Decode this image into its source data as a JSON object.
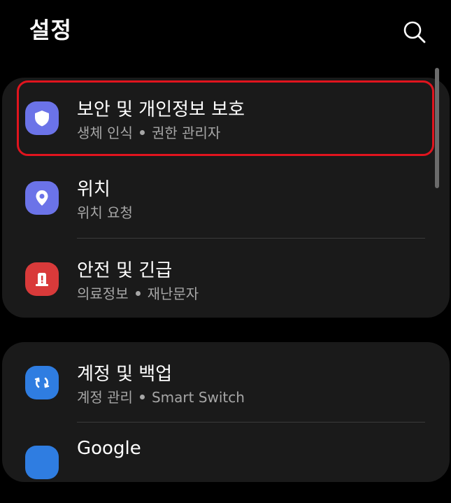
{
  "header": {
    "title": "설정"
  },
  "colors": {
    "highlight": "#e0141e",
    "security_icon_bg": "#6b73e8",
    "location_icon_bg": "#6b73e8",
    "safety_icon_bg": "#d93a3a",
    "accounts_icon_bg": "#2f7de1"
  },
  "groups": [
    {
      "items": [
        {
          "title": "보안 및 개인정보 보호",
          "sub_a": "생체 인식",
          "sub_b": "권한 관리자",
          "icon": "shield-icon"
        },
        {
          "title": "위치",
          "sub_a": "위치 요청",
          "icon": "location-pin-icon"
        },
        {
          "title": "안전 및 긴급",
          "sub_a": "의료정보",
          "sub_b": "재난문자",
          "icon": "emergency-icon"
        }
      ]
    },
    {
      "items": [
        {
          "title": "계정 및 백업",
          "sub_a": "계정 관리",
          "sub_b": "Smart Switch",
          "icon": "sync-icon"
        },
        {
          "title": "Google",
          "icon": "google-icon"
        }
      ]
    }
  ]
}
